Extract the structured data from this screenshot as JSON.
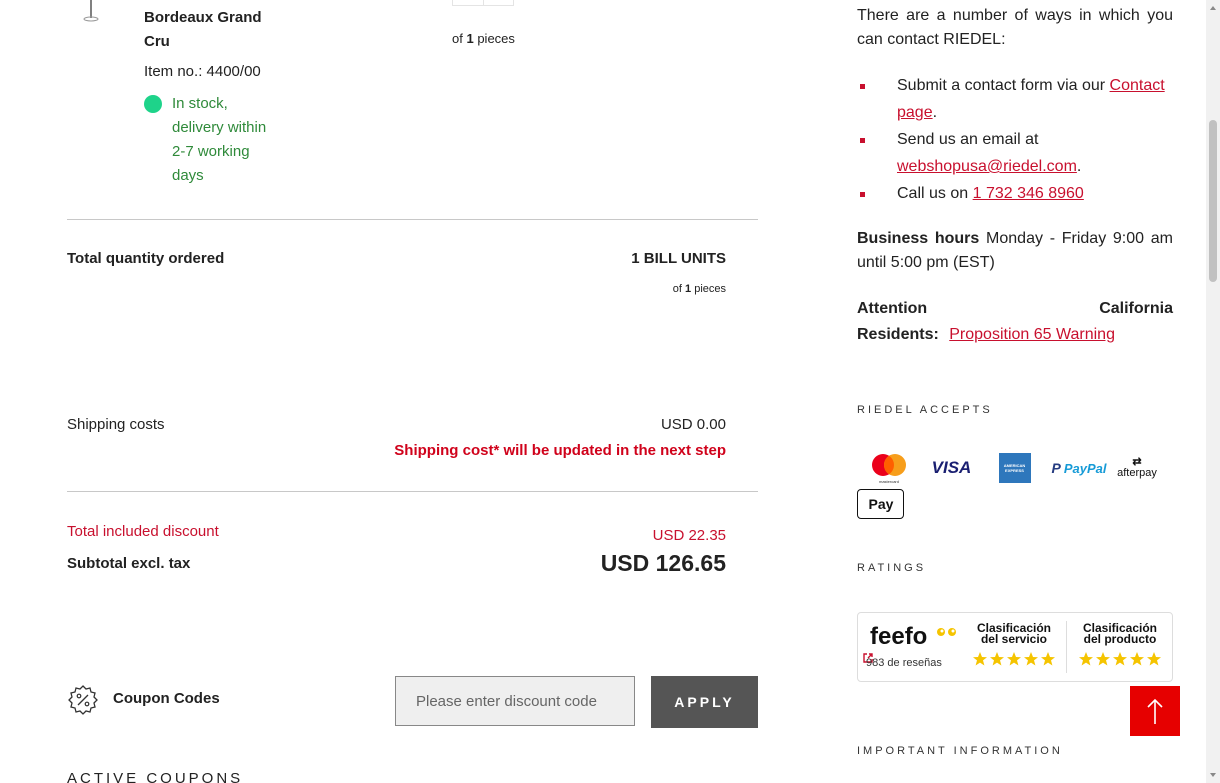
{
  "cart_item": {
    "name_line1": "Bordeaux Grand",
    "name_line2": "Cru",
    "item_no": "Item no.: 4400/00",
    "stock_text": "In stock, delivery within 2-7 working days",
    "of_pieces_prefix": "of",
    "of_pieces_count": "1",
    "of_pieces_suffix": "pieces"
  },
  "summary": {
    "total_quantity_label": "Total quantity ordered",
    "total_quantity_value": "1 BILL UNITS",
    "total_quantity_sub_prefix": "of",
    "total_quantity_sub_count": "1",
    "total_quantity_sub_suffix": "pieces",
    "shipping_label": "Shipping costs",
    "shipping_value": "USD 0.00",
    "shipping_note": "Shipping cost* will be updated in the next step",
    "discount_label": "Total included discount",
    "discount_value": "USD 22.35",
    "subtotal_label": "Subtotal excl. tax",
    "subtotal_value": "USD 126.65"
  },
  "coupon": {
    "label": "Coupon Codes",
    "placeholder": "Please enter discount code",
    "apply_label": "APPLY",
    "active_coupons_title": "ACTIVE COUPONS"
  },
  "contact": {
    "intro": "There are a number of ways in which you can contact RIEDEL:",
    "item1_prefix": "Submit a contact form via our",
    "item1_link": "Contact page",
    "item1_suffix": ".",
    "item2_prefix": "Send us an email at",
    "item2_link": "webshopusa@riedel.com",
    "item2_suffix": ".",
    "item3_prefix": "Call us on",
    "item3_link": "1 732 346 8960",
    "business_hours_label": "Business hours",
    "business_hours_text": "Monday - Friday 9:00 am until 5:00 pm (EST)",
    "attention_word1": "Attention",
    "attention_word2": "California",
    "residents_label": "Residents:",
    "prop65_link": "Proposition 65 Warning"
  },
  "accepts": {
    "title": "RIEDEL ACCEPTS",
    "mastercard_caption": "mastercard",
    "visa": "VISA",
    "amex": "AMERICAN EXPRESS",
    "paypal": "PayPal",
    "afterpay": "afterpay",
    "applepay": "Pay"
  },
  "ratings": {
    "title": "RATINGS",
    "feefo_logo": "feefo",
    "review_count": "983 de reseñas",
    "service_line1": "Clasificación",
    "service_line2": "del servicio",
    "product_line1": "Clasificación",
    "product_line2": "del producto",
    "service_stars": 5,
    "product_stars": 5
  },
  "important_title": "IMPORTANT INFORMATION",
  "colors": {
    "accent_red": "#c8102e",
    "stock_green": "#1ed38a",
    "button_gray": "#555555",
    "star_yellow": "#f5c400"
  }
}
